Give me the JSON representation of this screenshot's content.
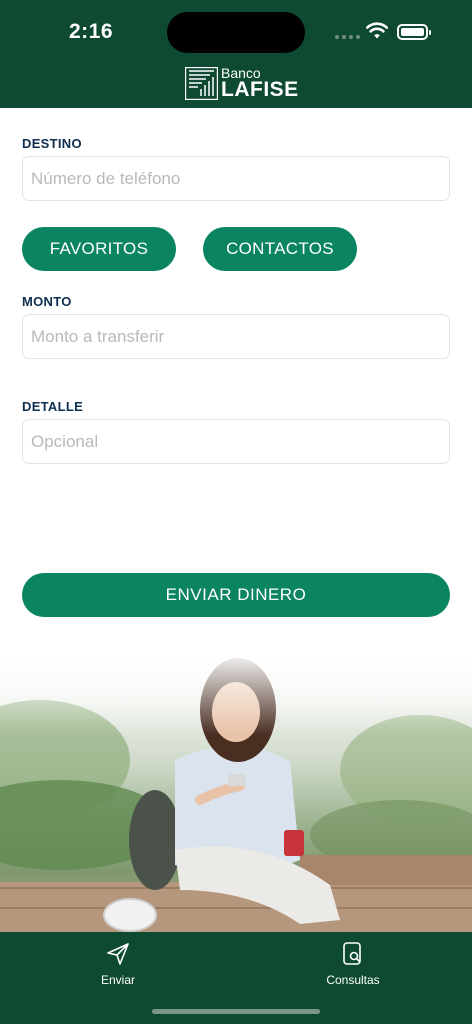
{
  "status_bar": {
    "time": "2:16"
  },
  "header": {
    "logo_line1": "Banco",
    "logo_line2": "LAFISE"
  },
  "form": {
    "destino": {
      "label": "DESTINO",
      "placeholder": "Número de teléfono",
      "value": ""
    },
    "favoritos_label": "FAVORITOS",
    "contactos_label": "CONTACTOS",
    "monto": {
      "label": "MONTO",
      "placeholder": "Monto a transferir",
      "value": ""
    },
    "detalle": {
      "label": "DETALLE",
      "placeholder": "Opcional",
      "value": ""
    },
    "submit_label": "ENVIAR DINERO"
  },
  "tabbar": {
    "items": [
      {
        "label": "Enviar",
        "icon": "send-icon"
      },
      {
        "label": "Consultas",
        "icon": "document-search-icon"
      }
    ]
  },
  "colors": {
    "header_bg": "#0e4a32",
    "accent": "#0b8462",
    "label_text": "#0e2f4f"
  }
}
